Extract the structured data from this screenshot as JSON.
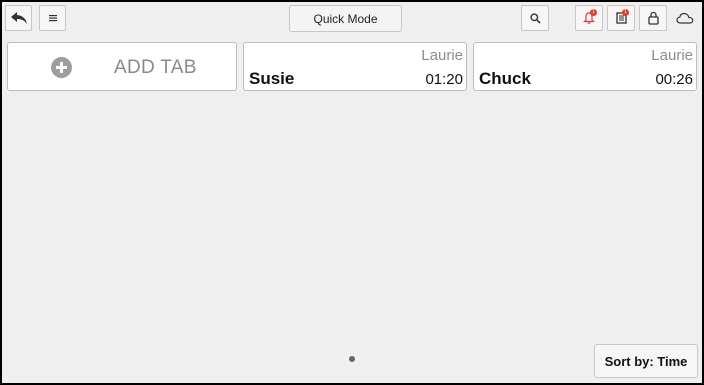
{
  "toolbar": {
    "back_icon": "back-arrow-icon",
    "menu_icon": "hamburger-menu-icon",
    "quick_mode_label": "Quick Mode",
    "search_icon": "search-icon",
    "notifications_icon": "bell-icon",
    "notifications_badge": "1",
    "orders_icon": "receipt-icon",
    "orders_badge": "1",
    "lock_icon": "lock-icon",
    "cloud_icon": "cloud-icon"
  },
  "tabs": {
    "add_tab_label": "ADD TAB",
    "items": [
      {
        "server": "Laurie",
        "name": "Susie",
        "time": "01:20"
      },
      {
        "server": "Laurie",
        "name": "Chuck",
        "time": "00:26"
      }
    ]
  },
  "footer": {
    "sort_label": "Sort by: Time"
  },
  "colors": {
    "background": "#efefef",
    "card": "#ffffff",
    "badge": "#e53935",
    "accent_bell": "#e53935"
  }
}
